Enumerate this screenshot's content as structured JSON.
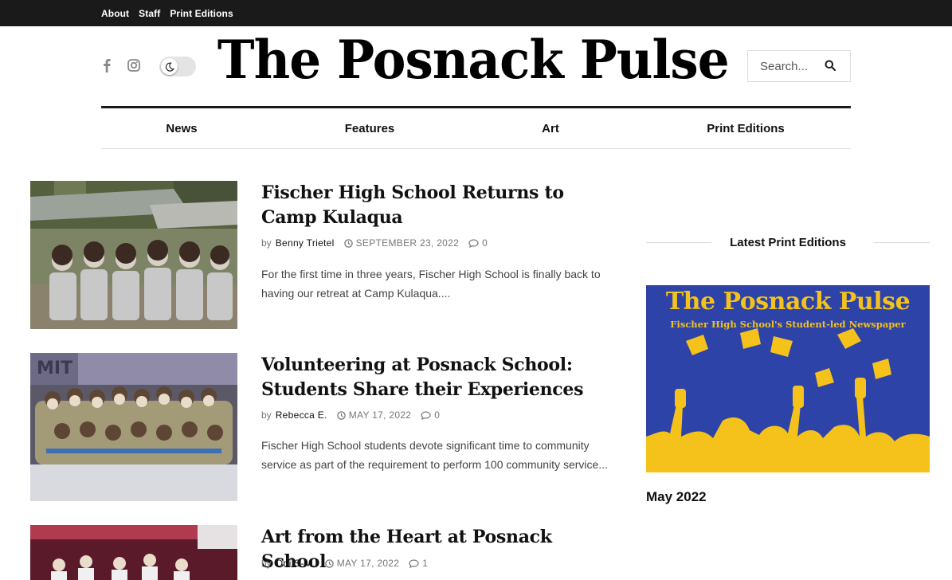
{
  "topbar": {
    "links": [
      "About",
      "Staff",
      "Print Editions"
    ]
  },
  "header": {
    "logo_text": "The Posnack Pulse",
    "search_placeholder": "Search..."
  },
  "nav": {
    "items": [
      "News",
      "Features",
      "Art",
      "Print Editions"
    ]
  },
  "articles": [
    {
      "title": "Fischer High School Returns to Camp Kulaqua",
      "by": "by",
      "author": "Benny Trietel",
      "date": "SEPTEMBER 23, 2022",
      "comments": "0",
      "excerpt": "For the first time in three years, Fischer High School is finally back to having our retreat at Camp Kulaqua...."
    },
    {
      "title": "Volunteering at Posnack School: Students Share their Experiences",
      "by": "by",
      "author": "Rebecca E.",
      "date": "MAY 17, 2022",
      "comments": "0",
      "excerpt": "Fischer High School students devote significant time to community service as part of the requirement to perform 100 community service..."
    },
    {
      "title": "Art from the Heart at Posnack School",
      "by": "by",
      "author": "Orli S-M.",
      "date": "MAY 17, 2022",
      "comments": "1",
      "excerpt": ""
    }
  ],
  "sidebar": {
    "section_title": "Latest Print Editions",
    "cover_title": "The Posnack Pulse",
    "cover_subtitle": "Fischer High School's Student-led Newspaper",
    "edition_label": "May 2022"
  },
  "colors": {
    "topbar": "#1a1a1a",
    "cover_bg": "#2d43a8",
    "cover_accent": "#f4c21b"
  }
}
